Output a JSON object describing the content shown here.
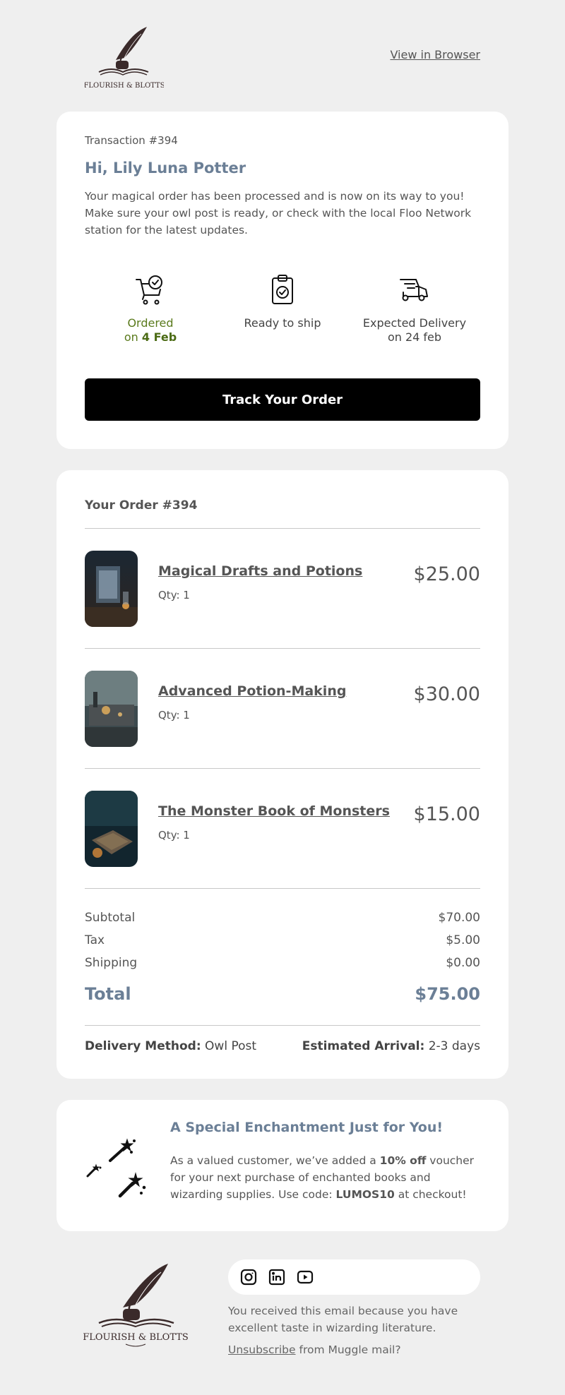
{
  "header": {
    "brand_text": "FLOURISH & BLOTTS",
    "view_in_browser": "View in Browser"
  },
  "transaction": {
    "label": "Transaction #394",
    "greeting": "Hi, Lily Luna Potter",
    "message": "Your magical order has been processed and is now on its way to you! Make sure your owl post is ready, or check with the local Floo Network station for the latest updates."
  },
  "steps": [
    {
      "icon": "cart-check-icon",
      "line1": "Ordered",
      "line2_prefix": "on ",
      "line2_bold": "4 Feb",
      "color": "#5a7a1c"
    },
    {
      "icon": "clipboard-check-icon",
      "line1": "Ready to ship"
    },
    {
      "icon": "delivery-truck-icon",
      "line1": "Expected Delivery",
      "line2": "on 24 feb"
    }
  ],
  "track_button": "Track Your Order",
  "order": {
    "title": "Your Order #394",
    "items": [
      {
        "name": "Magical Drafts and Potions",
        "qty": "Qty: 1",
        "price": "$25.00"
      },
      {
        "name": "Advanced Potion-Making",
        "qty": "Qty: 1",
        "price": "$30.00"
      },
      {
        "name": "The Monster Book of Monsters",
        "qty": "Qty: 1",
        "price": "$15.00"
      }
    ],
    "summary": {
      "subtotal_label": "Subtotal",
      "subtotal": "$70.00",
      "tax_label": "Tax",
      "tax": "$5.00",
      "shipping_label": "Shipping",
      "shipping": "$0.00",
      "total_label": "Total",
      "total": "$75.00"
    },
    "delivery": {
      "method_label": "Delivery Method:",
      "method": "Owl Post",
      "arrival_label": "Estimated Arrival:",
      "arrival": "2-3 days"
    }
  },
  "promo": {
    "title": "A Special Enchantment Just for You!",
    "text_1": "As a valued customer, we’ve added a ",
    "bold_1": "10% off",
    "text_2": " voucher for your next purchase of enchanted books and wizarding supplies. Use code: ",
    "code": "LUMOS10",
    "text_3": " at checkout!"
  },
  "footer": {
    "brand_text": "FLOURISH & BLOTTS",
    "social_icons": [
      "instagram-icon",
      "linkedin-icon",
      "youtube-icon"
    ],
    "note": "You received this email because you have excellent taste in wizarding literature.",
    "unsubscribe_link": "Unsubscribe",
    "unsubscribe_rest": " from Muggle mail?"
  },
  "colors": {
    "background": "#efefef",
    "accent": "#6b7f96",
    "ordered_green": "#5a7a1c",
    "button": "#000000"
  }
}
